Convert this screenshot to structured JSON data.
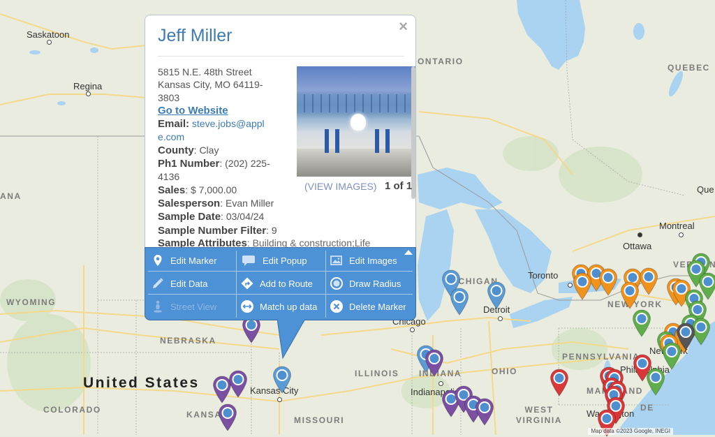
{
  "map": {
    "labels": {
      "cities": [
        {
          "name": "Saskatoon"
        },
        {
          "name": "Regina"
        },
        {
          "name": "Toronto"
        },
        {
          "name": "Ottawa"
        },
        {
          "name": "Montreal"
        },
        {
          "name": "Que"
        },
        {
          "name": "Detroit"
        },
        {
          "name": "Chicago"
        },
        {
          "name": "Indianapolis"
        },
        {
          "name": "Kansas City"
        },
        {
          "name": "Philadelphia"
        },
        {
          "name": "Washington"
        },
        {
          "name": "New York"
        }
      ],
      "regions": [
        {
          "name": "ONTARIO"
        },
        {
          "name": "QUEBEC"
        },
        {
          "name": "ANA"
        },
        {
          "name": "WYOMING"
        },
        {
          "name": "NEBRASKA"
        },
        {
          "name": "COLORADO"
        },
        {
          "name": "KANSAS"
        },
        {
          "name": "MISSOURI"
        },
        {
          "name": "ILLINOIS"
        },
        {
          "name": "INDIANA"
        },
        {
          "name": "OHIO"
        },
        {
          "name": "MICHIGAN"
        },
        {
          "name": "PENNSYLVANIA"
        },
        {
          "name": "NEW YORK"
        },
        {
          "name": "WEST VIRGINIA"
        },
        {
          "name": "MARYLAND"
        },
        {
          "name": "VERMONT"
        },
        {
          "name": "DE"
        }
      ],
      "country": "United States"
    },
    "marker_colors": {
      "blue": "#5b9bd5",
      "purple": "#7b4fa2",
      "orange": "#f0921e",
      "green": "#5fae4b",
      "red": "#d9383a",
      "dark": "#555555"
    },
    "attribution": "Map data ©2023 Google, INEGI"
  },
  "popup": {
    "title": "Jeff Miller",
    "close_label": "×",
    "address_line1": "5815 N.E. 48th Street",
    "address_line2": "Kansas City, MO 64119-",
    "address_line3": "3803",
    "website_link": "Go to Website",
    "fields": {
      "email_label": "Email:",
      "email_value_a": "steve.jobs@appl",
      "email_value_b": "e.com",
      "county_label": "County",
      "county_value": ": Clay",
      "phone_label": "Ph1 Number",
      "phone_value_a": ": (202) 225-",
      "phone_value_b": "4136",
      "sales_label": "Sales",
      "sales_value": ": $ 7,000.00",
      "salesperson_label": "Salesperson",
      "salesperson_value": ": Evan Miller",
      "sample_date_label": "Sample Date",
      "sample_date_value": ": 03/04/24",
      "sample_number_label": "Sample Number Filter",
      "sample_number_value": ": 9",
      "sample_attributes_label": "Sample Attributes",
      "sample_attributes_value": ": Building & construction;Life"
    },
    "image": {
      "alt": "Apple store glass canopy",
      "view_images_label": "(VIEW IMAGES)",
      "count": "1 of 1"
    },
    "toolbar": {
      "edit_marker": "Edit Marker",
      "edit_popup": "Edit Popup",
      "edit_images": "Edit Images",
      "edit_data": "Edit Data",
      "add_to_route": "Add to Route",
      "draw_radius": "Draw Radius",
      "street_view": "Street View",
      "match_up_data": "Match up data",
      "delete_marker": "Delete Marker"
    }
  }
}
